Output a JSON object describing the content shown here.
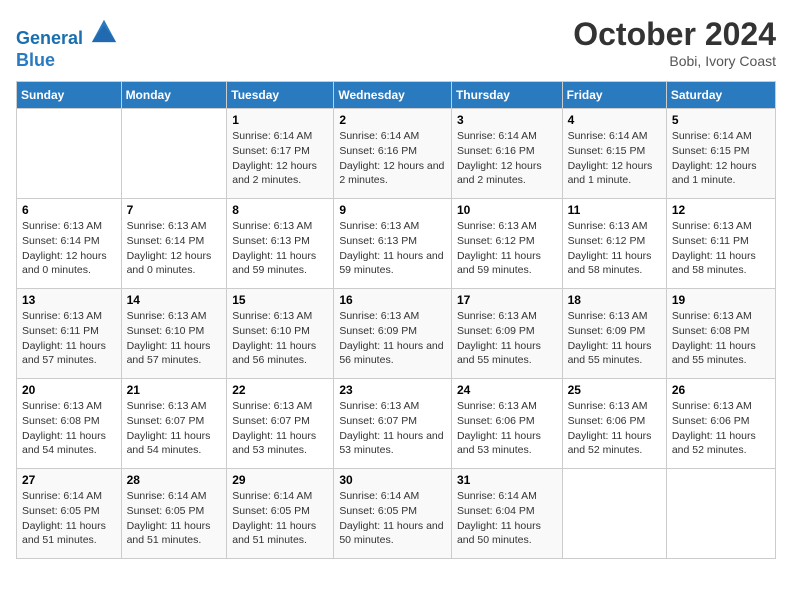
{
  "header": {
    "logo_line1": "General",
    "logo_line2": "Blue",
    "month_title": "October 2024",
    "location": "Bobi, Ivory Coast"
  },
  "days_of_week": [
    "Sunday",
    "Monday",
    "Tuesday",
    "Wednesday",
    "Thursday",
    "Friday",
    "Saturday"
  ],
  "weeks": [
    [
      {
        "day": "",
        "info": ""
      },
      {
        "day": "",
        "info": ""
      },
      {
        "day": "1",
        "info": "Sunrise: 6:14 AM\nSunset: 6:17 PM\nDaylight: 12 hours and 2 minutes."
      },
      {
        "day": "2",
        "info": "Sunrise: 6:14 AM\nSunset: 6:16 PM\nDaylight: 12 hours and 2 minutes."
      },
      {
        "day": "3",
        "info": "Sunrise: 6:14 AM\nSunset: 6:16 PM\nDaylight: 12 hours and 2 minutes."
      },
      {
        "day": "4",
        "info": "Sunrise: 6:14 AM\nSunset: 6:15 PM\nDaylight: 12 hours and 1 minute."
      },
      {
        "day": "5",
        "info": "Sunrise: 6:14 AM\nSunset: 6:15 PM\nDaylight: 12 hours and 1 minute."
      }
    ],
    [
      {
        "day": "6",
        "info": "Sunrise: 6:13 AM\nSunset: 6:14 PM\nDaylight: 12 hours and 0 minutes."
      },
      {
        "day": "7",
        "info": "Sunrise: 6:13 AM\nSunset: 6:14 PM\nDaylight: 12 hours and 0 minutes."
      },
      {
        "day": "8",
        "info": "Sunrise: 6:13 AM\nSunset: 6:13 PM\nDaylight: 11 hours and 59 minutes."
      },
      {
        "day": "9",
        "info": "Sunrise: 6:13 AM\nSunset: 6:13 PM\nDaylight: 11 hours and 59 minutes."
      },
      {
        "day": "10",
        "info": "Sunrise: 6:13 AM\nSunset: 6:12 PM\nDaylight: 11 hours and 59 minutes."
      },
      {
        "day": "11",
        "info": "Sunrise: 6:13 AM\nSunset: 6:12 PM\nDaylight: 11 hours and 58 minutes."
      },
      {
        "day": "12",
        "info": "Sunrise: 6:13 AM\nSunset: 6:11 PM\nDaylight: 11 hours and 58 minutes."
      }
    ],
    [
      {
        "day": "13",
        "info": "Sunrise: 6:13 AM\nSunset: 6:11 PM\nDaylight: 11 hours and 57 minutes."
      },
      {
        "day": "14",
        "info": "Sunrise: 6:13 AM\nSunset: 6:10 PM\nDaylight: 11 hours and 57 minutes."
      },
      {
        "day": "15",
        "info": "Sunrise: 6:13 AM\nSunset: 6:10 PM\nDaylight: 11 hours and 56 minutes."
      },
      {
        "day": "16",
        "info": "Sunrise: 6:13 AM\nSunset: 6:09 PM\nDaylight: 11 hours and 56 minutes."
      },
      {
        "day": "17",
        "info": "Sunrise: 6:13 AM\nSunset: 6:09 PM\nDaylight: 11 hours and 55 minutes."
      },
      {
        "day": "18",
        "info": "Sunrise: 6:13 AM\nSunset: 6:09 PM\nDaylight: 11 hours and 55 minutes."
      },
      {
        "day": "19",
        "info": "Sunrise: 6:13 AM\nSunset: 6:08 PM\nDaylight: 11 hours and 55 minutes."
      }
    ],
    [
      {
        "day": "20",
        "info": "Sunrise: 6:13 AM\nSunset: 6:08 PM\nDaylight: 11 hours and 54 minutes."
      },
      {
        "day": "21",
        "info": "Sunrise: 6:13 AM\nSunset: 6:07 PM\nDaylight: 11 hours and 54 minutes."
      },
      {
        "day": "22",
        "info": "Sunrise: 6:13 AM\nSunset: 6:07 PM\nDaylight: 11 hours and 53 minutes."
      },
      {
        "day": "23",
        "info": "Sunrise: 6:13 AM\nSunset: 6:07 PM\nDaylight: 11 hours and 53 minutes."
      },
      {
        "day": "24",
        "info": "Sunrise: 6:13 AM\nSunset: 6:06 PM\nDaylight: 11 hours and 53 minutes."
      },
      {
        "day": "25",
        "info": "Sunrise: 6:13 AM\nSunset: 6:06 PM\nDaylight: 11 hours and 52 minutes."
      },
      {
        "day": "26",
        "info": "Sunrise: 6:13 AM\nSunset: 6:06 PM\nDaylight: 11 hours and 52 minutes."
      }
    ],
    [
      {
        "day": "27",
        "info": "Sunrise: 6:14 AM\nSunset: 6:05 PM\nDaylight: 11 hours and 51 minutes."
      },
      {
        "day": "28",
        "info": "Sunrise: 6:14 AM\nSunset: 6:05 PM\nDaylight: 11 hours and 51 minutes."
      },
      {
        "day": "29",
        "info": "Sunrise: 6:14 AM\nSunset: 6:05 PM\nDaylight: 11 hours and 51 minutes."
      },
      {
        "day": "30",
        "info": "Sunrise: 6:14 AM\nSunset: 6:05 PM\nDaylight: 11 hours and 50 minutes."
      },
      {
        "day": "31",
        "info": "Sunrise: 6:14 AM\nSunset: 6:04 PM\nDaylight: 11 hours and 50 minutes."
      },
      {
        "day": "",
        "info": ""
      },
      {
        "day": "",
        "info": ""
      }
    ]
  ]
}
